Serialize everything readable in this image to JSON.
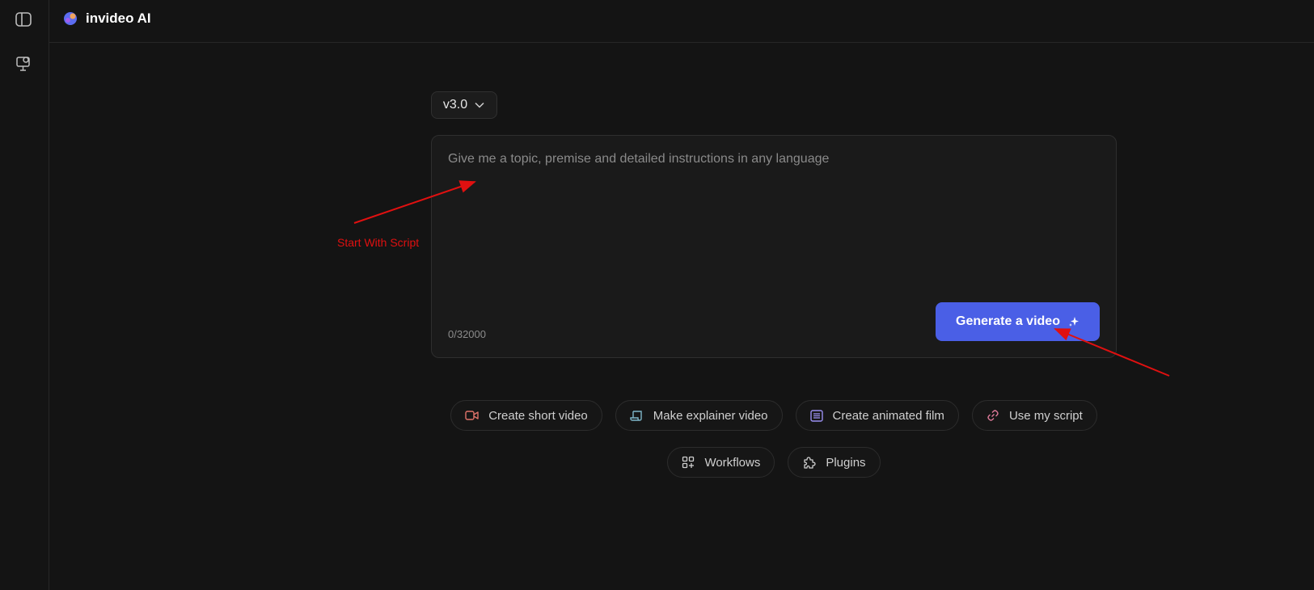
{
  "app": {
    "name": "invideo AI"
  },
  "sidebar": {
    "items": [
      {
        "icon": "sidebar-toggle-icon"
      },
      {
        "icon": "presentation-icon"
      }
    ]
  },
  "main": {
    "version_select": {
      "value": "v3.0",
      "icon": "chevron-down-icon"
    },
    "prompt": {
      "placeholder": "Give me a topic, premise and detailed instructions in any language",
      "value": "",
      "char_count": "0/32000"
    },
    "generate_button": {
      "label": "Generate a video",
      "icon": "sparkle-icon",
      "color": "#4a5fe6"
    },
    "quick_actions_row1": [
      {
        "label": "Create short video",
        "icon": "video-camera-icon",
        "color": "#e0736a"
      },
      {
        "label": "Make explainer video",
        "icon": "scroll-icon",
        "color": "#7fb6c9"
      },
      {
        "label": "Create animated film",
        "icon": "list-icon",
        "color": "#9a8ff0"
      },
      {
        "label": "Use my script",
        "icon": "link-icon",
        "color": "#e07a9a"
      }
    ],
    "quick_actions_row2": [
      {
        "label": "Workflows",
        "icon": "grid-plus-icon",
        "color": "#cfcfcf"
      },
      {
        "label": "Plugins",
        "icon": "puzzle-icon",
        "color": "#cfcfcf"
      }
    ]
  },
  "annotations": {
    "label": "Start With Script",
    "color": "#e01010"
  }
}
